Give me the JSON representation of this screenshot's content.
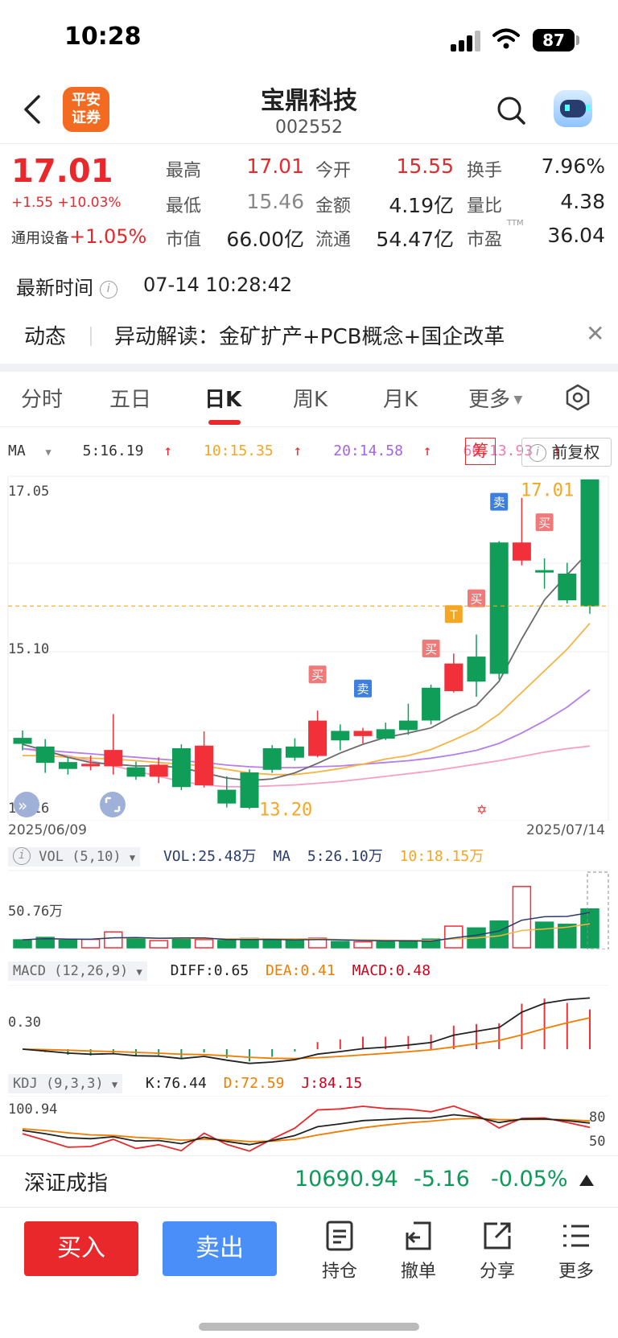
{
  "status_bar": {
    "time": "10:28",
    "battery": "87"
  },
  "header": {
    "logo_text": "平安证券",
    "title": "宝鼎科技",
    "code": "002552"
  },
  "quote": {
    "price": "17.01",
    "change": "+1.55 +10.03%",
    "sector_name": "通用设备",
    "sector_change": "+1.05%",
    "stats": [
      {
        "label": "最高",
        "value": "17.01"
      },
      {
        "label": "今开",
        "value": "15.55"
      },
      {
        "label": "换手",
        "value": "7.96%"
      },
      {
        "label": "最低",
        "value": "15.46"
      },
      {
        "label": "金额",
        "value": "4.19亿"
      },
      {
        "label": "量比",
        "value": "4.38"
      },
      {
        "label": "市值",
        "value": "66.00亿"
      },
      {
        "label": "流通",
        "value": "54.47亿"
      },
      {
        "label": "市盈",
        "value": "36.04"
      }
    ],
    "ttm_mark": "TTM",
    "latest_label": "最新时间",
    "latest_time": "07-14 10:28:42"
  },
  "news": {
    "label": "动态",
    "text": "异动解读：金矿扩产+PCB概念+国企改革"
  },
  "tabs": [
    "分时",
    "五日",
    "日K",
    "周K",
    "月K",
    "更多"
  ],
  "active_tab": "日K",
  "ma": {
    "label": "MA",
    "items": [
      {
        "text": "5:16.19",
        "color": "#333333"
      },
      {
        "text": "10:15.35",
        "color": "#f5a623"
      },
      {
        "text": "20:14.58",
        "color": "#a463e6"
      },
      {
        "text": "60:13.93",
        "color": "#f07ab3"
      }
    ],
    "chip": "筹",
    "adjust": "前复权"
  },
  "kline": {
    "y_max_label": "17.05",
    "y_mid_label": "15.10",
    "y_min_label": "13.16",
    "high_label": "17.01",
    "low_label": "13.20",
    "date_start": "2025/06/09",
    "date_end": "2025/07/14",
    "y_min": 13.16,
    "y_max": 17.05,
    "candles": [
      [
        14.02,
        13.96,
        14.11,
        13.88
      ],
      [
        13.92,
        13.74,
        14.01,
        13.62
      ],
      [
        13.74,
        13.67,
        13.8,
        13.6
      ],
      [
        13.7,
        13.72,
        13.82,
        13.65
      ],
      [
        13.7,
        13.88,
        14.3,
        13.6
      ],
      [
        13.68,
        13.58,
        13.75,
        13.54
      ],
      [
        13.58,
        13.71,
        13.8,
        13.5
      ],
      [
        13.9,
        13.46,
        13.95,
        13.42
      ],
      [
        13.48,
        13.93,
        14.1,
        13.45
      ],
      [
        13.42,
        13.27,
        13.58,
        13.22
      ],
      [
        13.62,
        13.22,
        13.66,
        13.2
      ],
      [
        13.9,
        13.66,
        13.94,
        13.62
      ],
      [
        13.92,
        13.8,
        14.02,
        13.76
      ],
      [
        13.82,
        14.22,
        14.34,
        13.8
      ],
      [
        14.1,
        14.0,
        14.18,
        13.88
      ],
      [
        14.05,
        14.1,
        14.14,
        13.96
      ],
      [
        14.12,
        14.02,
        14.2,
        14.0
      ],
      [
        14.22,
        14.12,
        14.42,
        14.06
      ],
      [
        14.6,
        14.23,
        14.64,
        14.18
      ],
      [
        14.57,
        14.88,
        15.0,
        14.55
      ],
      [
        14.96,
        14.68,
        15.22,
        14.5
      ],
      [
        16.28,
        14.77,
        16.3,
        14.7
      ],
      [
        16.08,
        16.28,
        16.8,
        16.02
      ],
      [
        15.96,
        15.95,
        16.1,
        15.75
      ],
      [
        15.92,
        15.62,
        16.05,
        15.58
      ],
      [
        17.01,
        15.55,
        17.01,
        15.46
      ]
    ],
    "ma5": [
      13.95,
      13.88,
      13.8,
      13.74,
      13.72,
      13.7,
      13.7,
      13.68,
      13.62,
      13.56,
      13.53,
      13.55,
      13.62,
      13.73,
      13.85,
      13.95,
      14.03,
      14.08,
      14.14,
      14.28,
      14.4,
      14.68,
      15.17,
      15.62,
      15.91,
      16.19
    ],
    "ma10": [
      13.82,
      13.82,
      13.8,
      13.79,
      13.78,
      13.76,
      13.74,
      13.72,
      13.7,
      13.66,
      13.62,
      13.6,
      13.6,
      13.63,
      13.67,
      13.72,
      13.78,
      13.82,
      13.89,
      14.0,
      14.12,
      14.3,
      14.55,
      14.8,
      15.05,
      15.35
    ],
    "ma20": [
      13.9,
      13.88,
      13.86,
      13.84,
      13.82,
      13.8,
      13.78,
      13.76,
      13.74,
      13.71,
      13.69,
      13.68,
      13.68,
      13.69,
      13.7,
      13.72,
      13.74,
      13.76,
      13.79,
      13.83,
      13.88,
      13.96,
      14.08,
      14.22,
      14.38,
      14.58
    ],
    "ma60": [
      13.9,
      13.86,
      13.82,
      13.76,
      13.7,
      13.64,
      13.58,
      13.52,
      13.48,
      13.46,
      13.46,
      13.47,
      13.48,
      13.5,
      13.52,
      13.55,
      13.58,
      13.61,
      13.64,
      13.68,
      13.72,
      13.76,
      13.81,
      13.86,
      13.9,
      13.93
    ],
    "markers": [
      {
        "i": 13,
        "text": "买",
        "type": "buy"
      },
      {
        "i": 15,
        "text": "卖",
        "type": "sell"
      },
      {
        "i": 18,
        "text": "买",
        "type": "buy"
      },
      {
        "i": 19,
        "text": "T",
        "type": "t"
      },
      {
        "i": 20,
        "text": "买",
        "type": "buy"
      },
      {
        "i": 21,
        "text": "卖",
        "type": "sell"
      },
      {
        "i": 23,
        "text": "买",
        "type": "buy"
      },
      {
        "i": 25,
        "text": "买",
        "type": "buy"
      }
    ]
  },
  "volume": {
    "chip": "VOL (5,10)",
    "vol_text": "VOL:25.48万",
    "ma_label": "MA",
    "ma5_text": "5:26.10万",
    "ma10_text": "10:18.15万",
    "y_label": "50.76万",
    "values": [
      5.2,
      6.8,
      4.9,
      5.5,
      10.4,
      5.8,
      4.7,
      6.1,
      5.4,
      4.8,
      6.2,
      5.0,
      4.6,
      6.3,
      4.1,
      3.9,
      3.8,
      4.5,
      5.7,
      14.2,
      13.0,
      17.5,
      40.2,
      16.8,
      15.4,
      25.48
    ]
  },
  "macd": {
    "chip": "MACD (12,26,9)",
    "diff_text": "DIFF:0.65",
    "dea_text": "DEA:0.41",
    "macd_text": "MACD:0.48",
    "y_label": "0.30"
  },
  "kdj": {
    "chip": "KDJ (9,3,3)",
    "k_text": "K:76.44",
    "d_text": "D:72.59",
    "j_text": "J:84.15",
    "y_label": "100.94",
    "r1": "80",
    "r2": "50"
  },
  "index_bar": {
    "name": "深证成指",
    "value": "10690.94",
    "change": "-5.16",
    "pct": "-0.05%"
  },
  "actions": {
    "buy": "买入",
    "sell": "卖出",
    "tools": [
      "持仓",
      "撤单",
      "分享",
      "更多"
    ]
  }
}
